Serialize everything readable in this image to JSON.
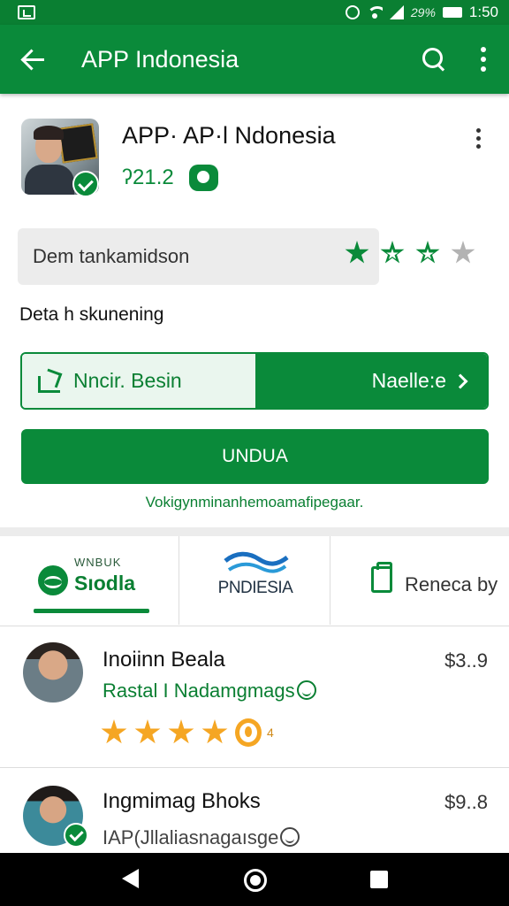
{
  "status_bar": {
    "battery_pct": "29%",
    "time": "1:50"
  },
  "app_bar": {
    "title": "APP Indonesia"
  },
  "app_header": {
    "name": "APP· AP·l Ndonesia",
    "version": "ʔ21.2"
  },
  "rating": {
    "label": "Dem tankamidson",
    "stars_filled": 3,
    "stars_total": 4
  },
  "details": {
    "section_title": "Deta h skunening"
  },
  "actions": {
    "secondary_label": "Nncir. Besin",
    "next_label": "Naelle:e",
    "primary_label": "UNDUA",
    "helper_text": "Vokigynminanhemoamafipegaar."
  },
  "tabs": [
    {
      "small": "WNBUK",
      "label": "Sıodla"
    },
    {
      "label": "PNDIESIA"
    },
    {
      "label": "Reneca by"
    }
  ],
  "list": [
    {
      "title": "Inoiinn Beala",
      "price": "$3..9",
      "subtitle": "Rastal I Nadamgmags",
      "rating_stars": 4,
      "rating_count": "4"
    },
    {
      "title": "Ingmimag Bhoks",
      "price": "$9..8",
      "subtitle": "IAP(Jllaliasnagaısge"
    }
  ],
  "colors": {
    "brand_green": "#0a8a3a",
    "star_orange": "#f5a623"
  }
}
